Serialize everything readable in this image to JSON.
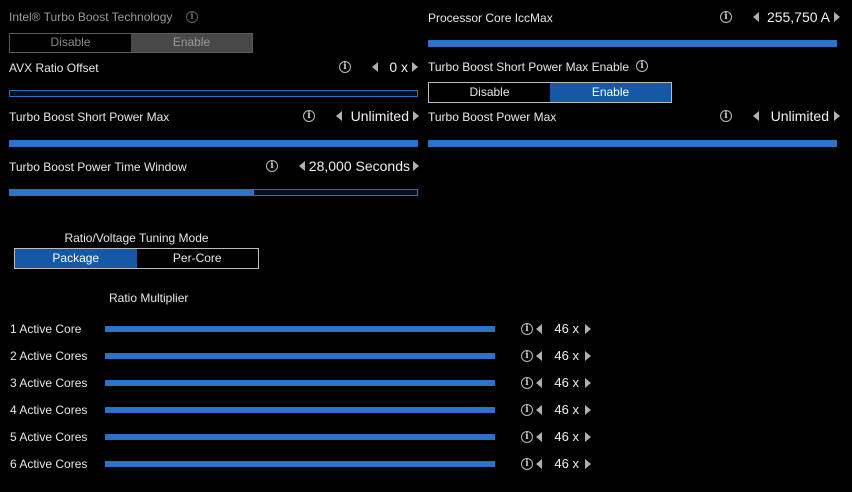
{
  "turbo_boost_tech": {
    "label": "Intel® Turbo Boost Technology",
    "options": [
      "Disable",
      "Enable"
    ],
    "selected": 1
  },
  "processor_core_iccmax": {
    "label": "Processor Core IccMax",
    "value": "255,750 A",
    "level": 1.0
  },
  "avx_ratio_offset": {
    "label": "AVX Ratio Offset",
    "value": "0 x",
    "level": 0.0
  },
  "tb_short_power_max_enable": {
    "label": "Turbo Boost Short Power Max Enable",
    "options": [
      "Disable",
      "Enable"
    ],
    "selected": 1
  },
  "tb_short_power_max": {
    "label": "Turbo Boost Short Power Max",
    "value": "Unlimited",
    "level": 1.0
  },
  "tb_power_max": {
    "label": "Turbo Boost Power Max",
    "value": "Unlimited",
    "level": 1.0
  },
  "tb_power_time_window": {
    "label": "Turbo Boost Power Time Window",
    "value": "28,000 Seconds",
    "level": 0.6
  },
  "tuning_mode": {
    "label": "Ratio/Voltage Tuning Mode",
    "options": [
      "Package",
      "Per-Core"
    ],
    "selected": 0
  },
  "ratio_multiplier": {
    "label": "Ratio Multiplier",
    "cores": [
      {
        "label": "1 Active Core",
        "value": "46 x",
        "level": 1.0
      },
      {
        "label": "2 Active Cores",
        "value": "46 x",
        "level": 1.0
      },
      {
        "label": "3 Active Cores",
        "value": "46 x",
        "level": 1.0
      },
      {
        "label": "4 Active Cores",
        "value": "46 x",
        "level": 1.0
      },
      {
        "label": "5 Active Cores",
        "value": "46 x",
        "level": 1.0
      },
      {
        "label": "6 Active Cores",
        "value": "46 x",
        "level": 1.0
      }
    ]
  },
  "icons": {
    "info": "info-icon",
    "decrease": "arrow-left-icon",
    "increase": "arrow-right-icon",
    "info_glyph": "i"
  },
  "colors": {
    "accent": "#1558a6",
    "slider_fill": "#2a74cc",
    "background": "#000000"
  }
}
